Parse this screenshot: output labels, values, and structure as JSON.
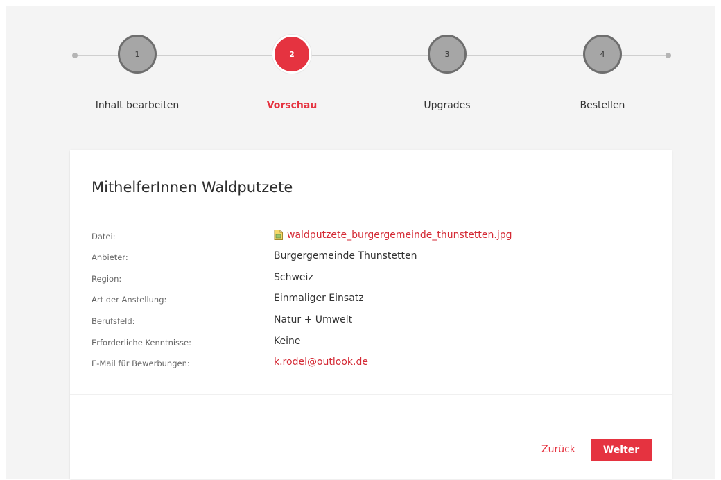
{
  "stepper": {
    "steps": [
      {
        "number": "1",
        "label": "Inhalt bearbeiten",
        "state": "inactive"
      },
      {
        "number": "2",
        "label": "Vorschau",
        "state": "active"
      },
      {
        "number": "3",
        "label": "Upgrades",
        "state": "inactive"
      },
      {
        "number": "4",
        "label": "Bestellen",
        "state": "inactive"
      }
    ]
  },
  "card": {
    "title": "MithelferInnen Waldputzete",
    "details": [
      {
        "label": "Datei:",
        "value": "waldputzete_burgergemeinde_thunstetten.jpg",
        "icon": "image-file-icon",
        "link": true
      },
      {
        "label": "Anbieter:",
        "value": "Burgergemeinde Thunstetten",
        "link": false
      },
      {
        "label": "Region:",
        "value": "Schweiz",
        "link": false
      },
      {
        "label": "Art der Anstellung:",
        "value": "Einmaliger Einsatz",
        "link": false
      },
      {
        "label": "Berufsfeld:",
        "value": "Natur + Umwelt",
        "link": false
      },
      {
        "label": "Erforderliche Kenntnisse:",
        "value": "Keine",
        "link": false
      },
      {
        "label": "E-Mail für Bewerbungen:",
        "value": "k.rodel@outlook.de",
        "link": true
      }
    ]
  },
  "actions": {
    "back_label": "Zurück",
    "next_label": "Welter"
  },
  "colors": {
    "accent": "#e53340",
    "background": "#f4f4f4",
    "inactive_step": "#a6a6a6"
  }
}
